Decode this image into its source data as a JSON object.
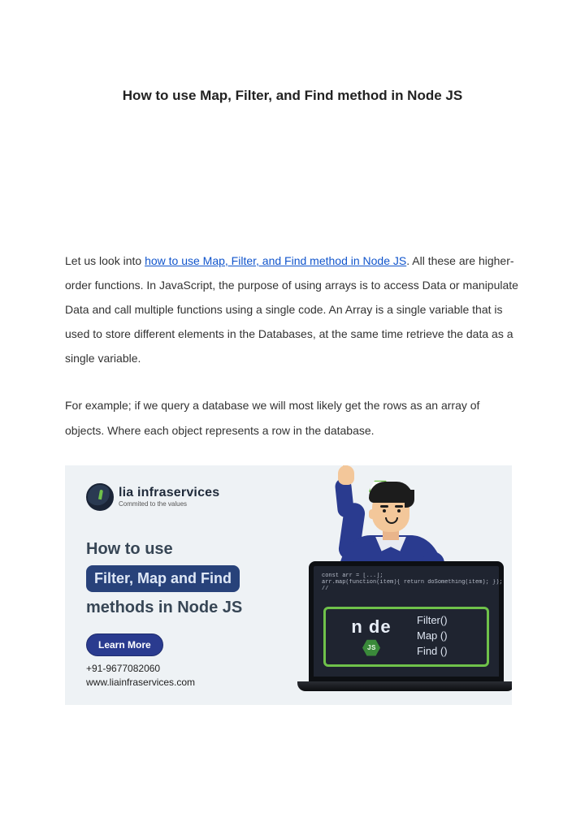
{
  "title": "How to use Map, Filter, and Find method in Node JS",
  "intro": {
    "lead_in": "Let us look into ",
    "link_text": "how to use Map, Filter, and Find method in Node JS",
    "after_link": ". All these are higher-order functions. In JavaScript, the purpose of using arrays is to access Data or manipulate Data and call multiple functions using a single code. An Array is a single variable that is used to store different elements in the Databases, at the same time retrieve the data as a single variable."
  },
  "para2": "For example;  if we query a database we will most likely get the rows as an array of objects. Where each object represents a row in the database.",
  "banner": {
    "brand_main_bold": "lia",
    "brand_main_rest": " infraservices",
    "brand_tag": "Commited to the values",
    "headline_row1": "How to use",
    "headline_pill": "Filter, Map and Find",
    "headline_row2": "methods in Node JS",
    "learn_more": "Learn More",
    "phone": "+91-9677082060",
    "site": "www.liainfraservices.com",
    "js_badge": "JS",
    "node_word": "n   de",
    "node_hex": "JS",
    "methods": [
      "Filter()",
      "Map ()",
      "Find ()"
    ],
    "code_lines": [
      "const arr = [...];",
      "",
      "arr.map(function(item){ return doSomething(item); });",
      "//"
    ]
  }
}
